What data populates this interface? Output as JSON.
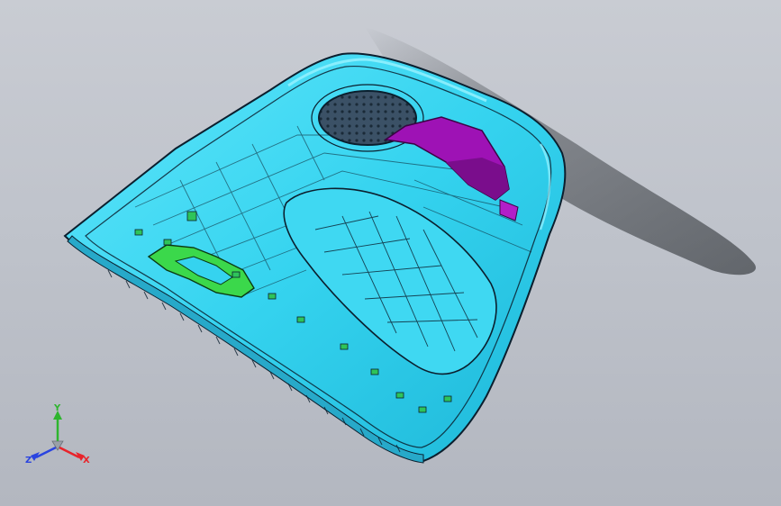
{
  "viewport": {
    "background": "#c3c6cd",
    "model": {
      "part_color": "#35d3ef",
      "edge_color": "#0b1f2e",
      "highlight_color": "#9af2ff",
      "bracket_color": "#9e12b5",
      "plate_color": "#3bd84b",
      "speaker_grille_color": "#2b3f52",
      "shadow_color": "#2e3236"
    }
  },
  "triad": {
    "x_label": "X",
    "y_label": "Y",
    "z_label": "Z",
    "x_color": "#e8242b",
    "y_color": "#2eb52e",
    "z_color": "#2a44e0"
  }
}
